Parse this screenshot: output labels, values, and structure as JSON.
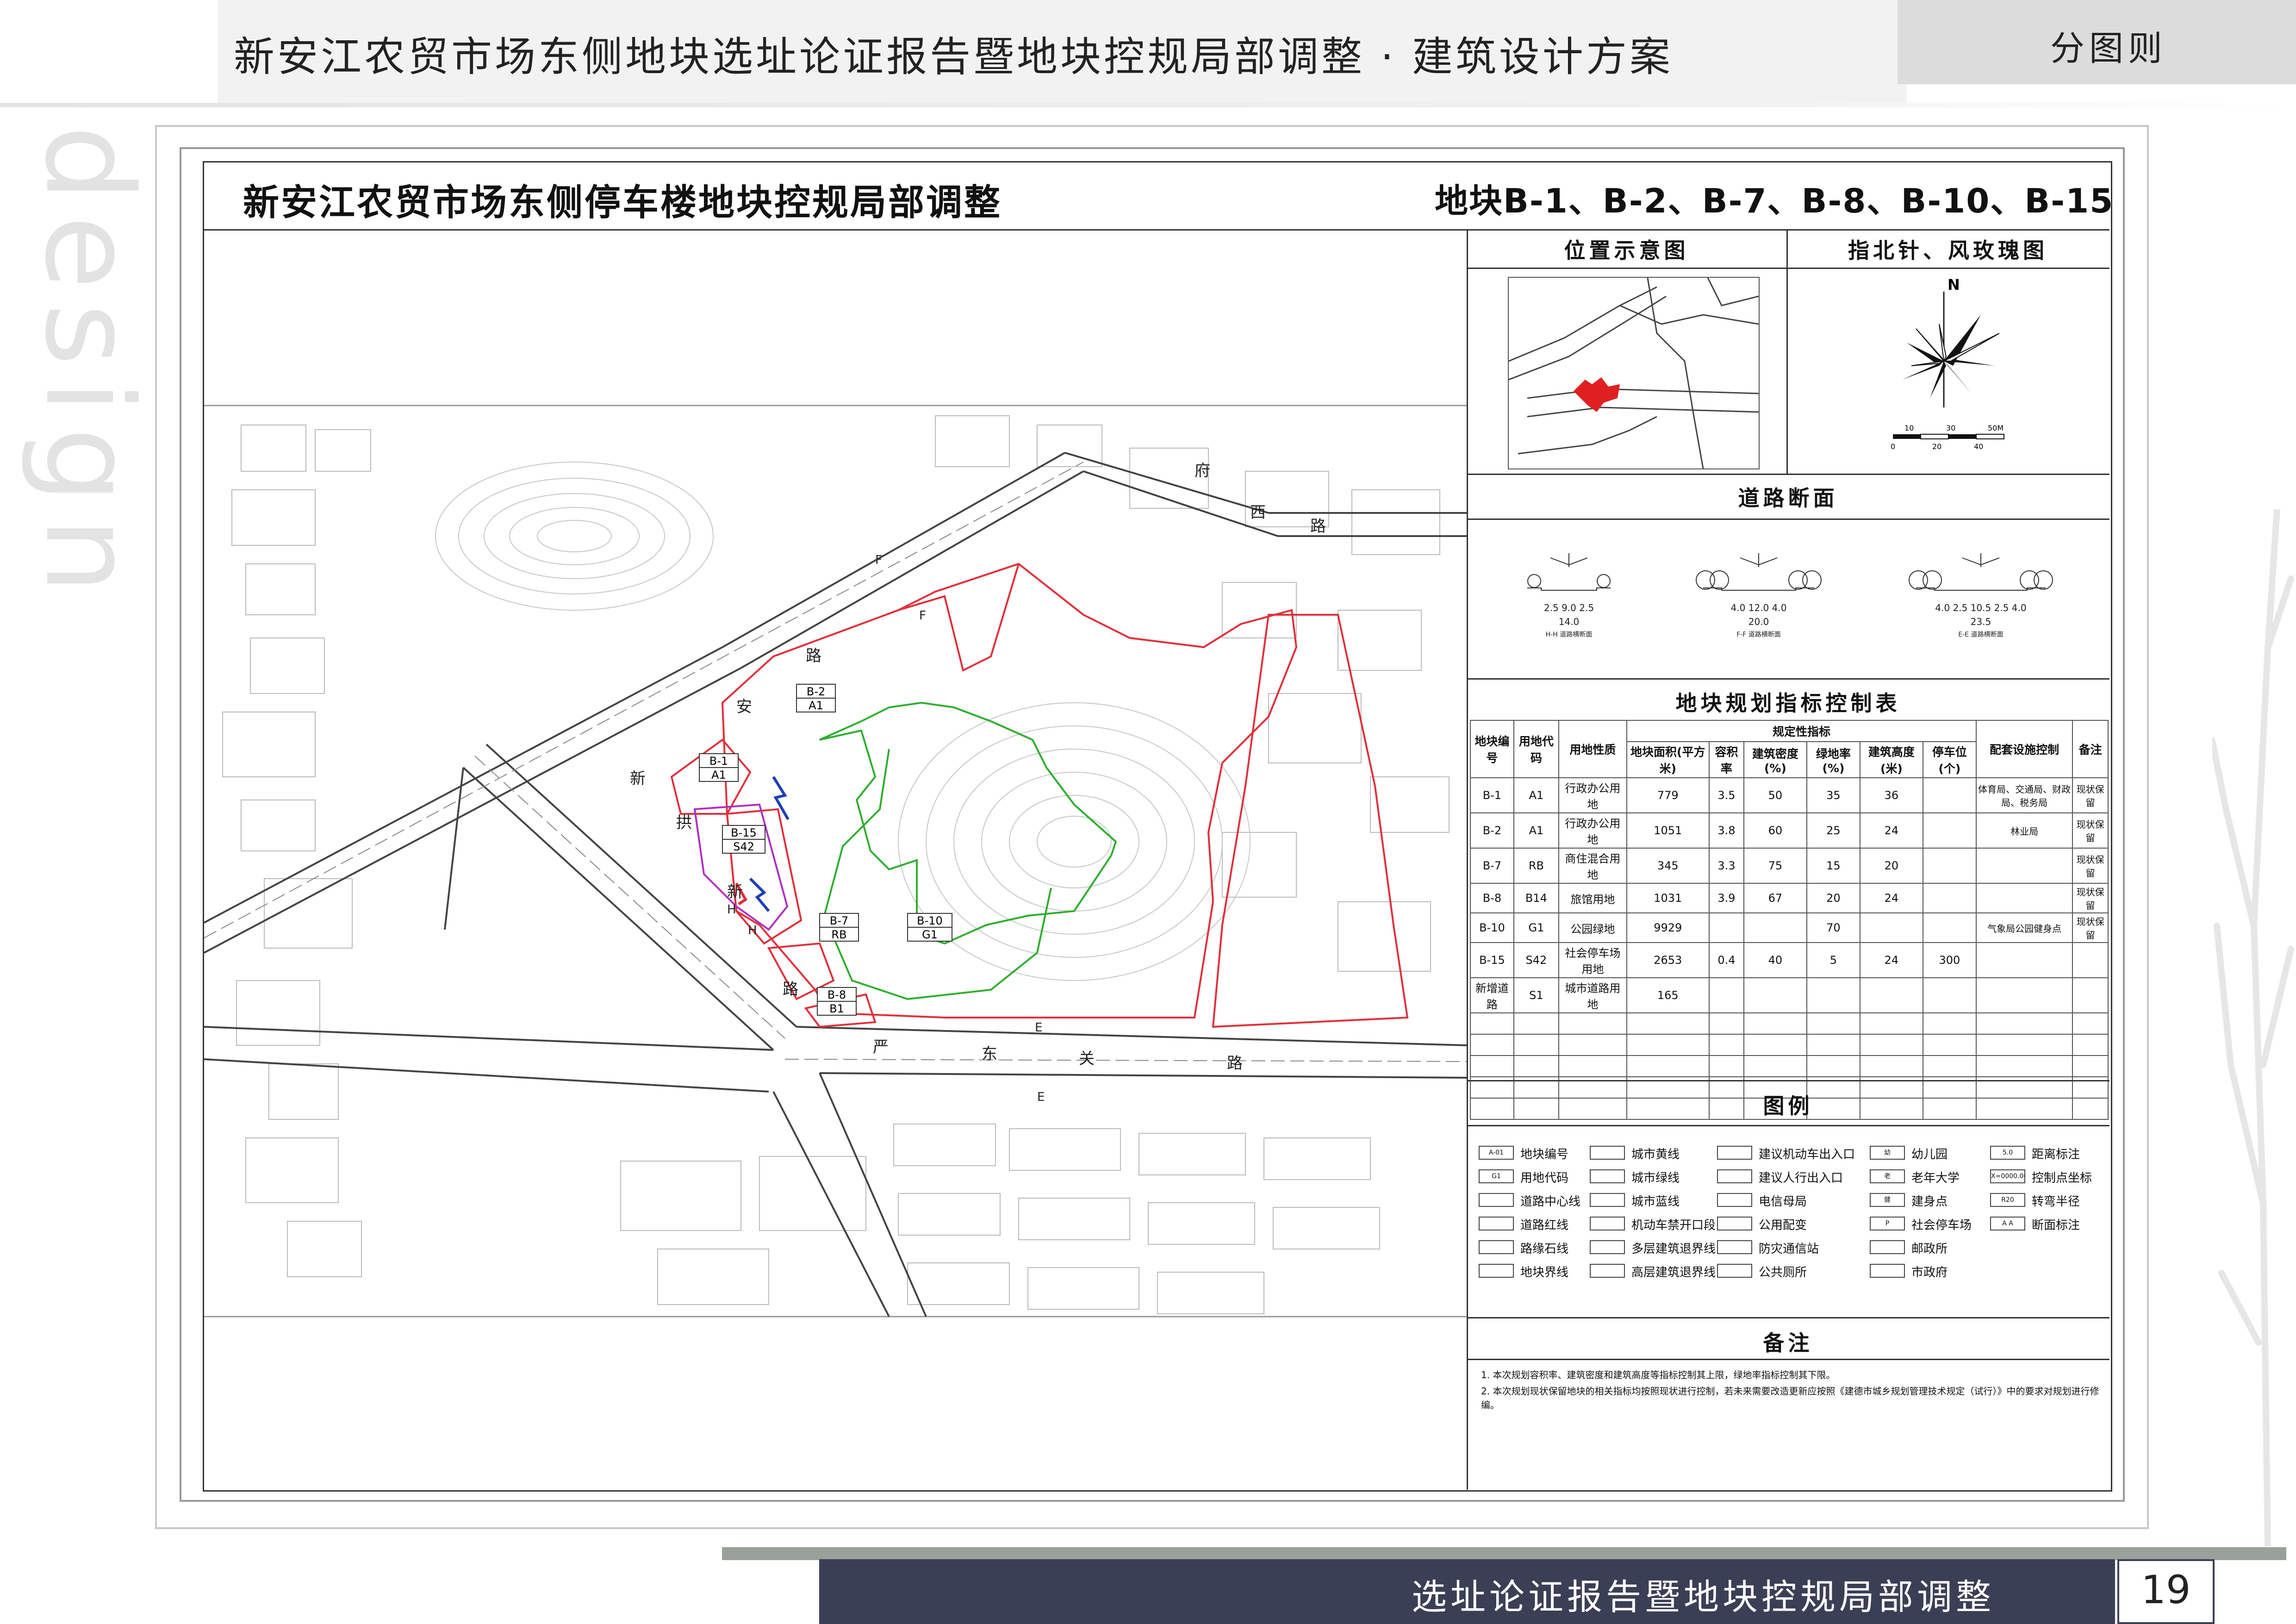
{
  "header": {
    "title": "新安江农贸市场东侧地块选址论证报告暨地块控规局部调整 · 建筑设计方案",
    "section": "分图则",
    "watermark": "design"
  },
  "sheet": {
    "title": "新安江农贸市场东侧停车楼地块控规局部调整",
    "parcels": "地块B-1、B-2、B-7、B-8、B-10、B-15"
  },
  "panels": {
    "location": "位置示意图",
    "compass": "指北针、风玫瑰图",
    "compass_n": "N",
    "scale_top": [
      "10",
      "30",
      "50M"
    ],
    "scale_bottom": [
      "0",
      "20",
      "40"
    ],
    "road_section": "道路断面",
    "index_table": "地块规划指标控制表",
    "legend": "图例",
    "remarks": "备注"
  },
  "road_sections": [
    {
      "dims": "2.5  9.0  2.5",
      "total": "14.0",
      "name": "H-H 道路横断面"
    },
    {
      "dims": "4.0  12.0  4.0",
      "total": "20.0",
      "name": "F-F 道路横断面"
    },
    {
      "dims": "4.0 2.5  10.5  2.5 4.0",
      "total": "23.5",
      "name": "E-E 道路横断面"
    }
  ],
  "table": {
    "group_header": "规定性指标",
    "headers": [
      "地块编号",
      "用地代码",
      "用地性质",
      "地块面积(平方米)",
      "容积率",
      "建筑密度(%)",
      "绿地率(%)",
      "建筑高度(米)",
      "停车位(个)",
      "配套设施控制",
      "备注"
    ],
    "rows": [
      [
        "B-1",
        "A1",
        "行政办公用地",
        "779",
        "3.5",
        "50",
        "35",
        "36",
        "",
        "体育局、交通局、财政局、税务局",
        "现状保留"
      ],
      [
        "B-2",
        "A1",
        "行政办公用地",
        "1051",
        "3.8",
        "60",
        "25",
        "24",
        "",
        "林业局",
        "现状保留"
      ],
      [
        "B-7",
        "RB",
        "商住混合用地",
        "345",
        "3.3",
        "75",
        "15",
        "20",
        "",
        "",
        "现状保留"
      ],
      [
        "B-8",
        "B14",
        "旅馆用地",
        "1031",
        "3.9",
        "67",
        "20",
        "24",
        "",
        "",
        "现状保留"
      ],
      [
        "B-10",
        "G1",
        "公园绿地",
        "9929",
        "",
        "",
        "70",
        "",
        "",
        "气象局公园健身点",
        "现状保留"
      ],
      [
        "B-15",
        "S42",
        "社会停车场用地",
        "2653",
        "0.4",
        "40",
        "5",
        "24",
        "300",
        "",
        ""
      ],
      [
        "新增道路",
        "S1",
        "城市道路用地",
        "165",
        "",
        "",
        "",
        "",
        "",
        "",
        ""
      ]
    ]
  },
  "legend": {
    "col1": [
      "地块编号",
      "用地代码",
      "道路中心线",
      "道路红线",
      "路缘石线",
      "地块界线"
    ],
    "col1_sym": [
      "A-01",
      "G1",
      "",
      "",
      "",
      ""
    ],
    "col2": [
      "城市黄线",
      "城市绿线",
      "城市蓝线",
      "机动车禁开口段",
      "多层建筑退界线",
      "高层建筑退界线"
    ],
    "col3": [
      "建议机动车出入口",
      "建议人行出入口",
      "电信母局",
      "公用配变",
      "防灾通信站",
      "公共厕所"
    ],
    "col4": [
      "幼儿园",
      "老年大学",
      "建身点",
      "社会停车场",
      "邮政所",
      "市政府"
    ],
    "col4_sym": [
      "幼",
      "老",
      "健",
      "P",
      "",
      ""
    ],
    "col5": [
      "距离标注",
      "控制点坐标",
      "转弯半径",
      "断面标注"
    ],
    "col5_sym": [
      "5.0",
      "X=0000.00 Y=0000.00",
      "R20",
      "A  A"
    ]
  },
  "remarks": [
    "1. 本次规划容积率、建筑密度和建筑高度等指标控制其上限，绿地率指标控制其下限。",
    "2. 本次规划现状保留地块的相关指标均按照现状进行控制，若未来需要改造更新应按照《建德市城乡规划管理技术规定（试行）》中的要求对规划进行修编。"
  ],
  "map_labels": {
    "roads": [
      "府",
      "西",
      "路",
      "路",
      "安",
      "新",
      "新",
      "拱",
      "路",
      "严",
      "东",
      "关",
      "路"
    ],
    "section_marks": [
      "F",
      "F",
      "H",
      "H",
      "E",
      "E"
    ],
    "parcels": [
      {
        "id": "B-2",
        "code": "A1"
      },
      {
        "id": "B-1",
        "code": "A1"
      },
      {
        "id": "B-15",
        "code": "S42"
      },
      {
        "id": "B-7",
        "code": "RB"
      },
      {
        "id": "B-10",
        "code": "G1"
      },
      {
        "id": "B-8",
        "code": "B1"
      }
    ]
  },
  "footer": {
    "text": "选址论证报告暨地块控规局部调整",
    "page": "19"
  },
  "colors": {
    "parcel_red": "#e0303a",
    "green_line": "#2fae2f",
    "purple_line": "#b030c0",
    "footer_band": "#3b3f55"
  }
}
